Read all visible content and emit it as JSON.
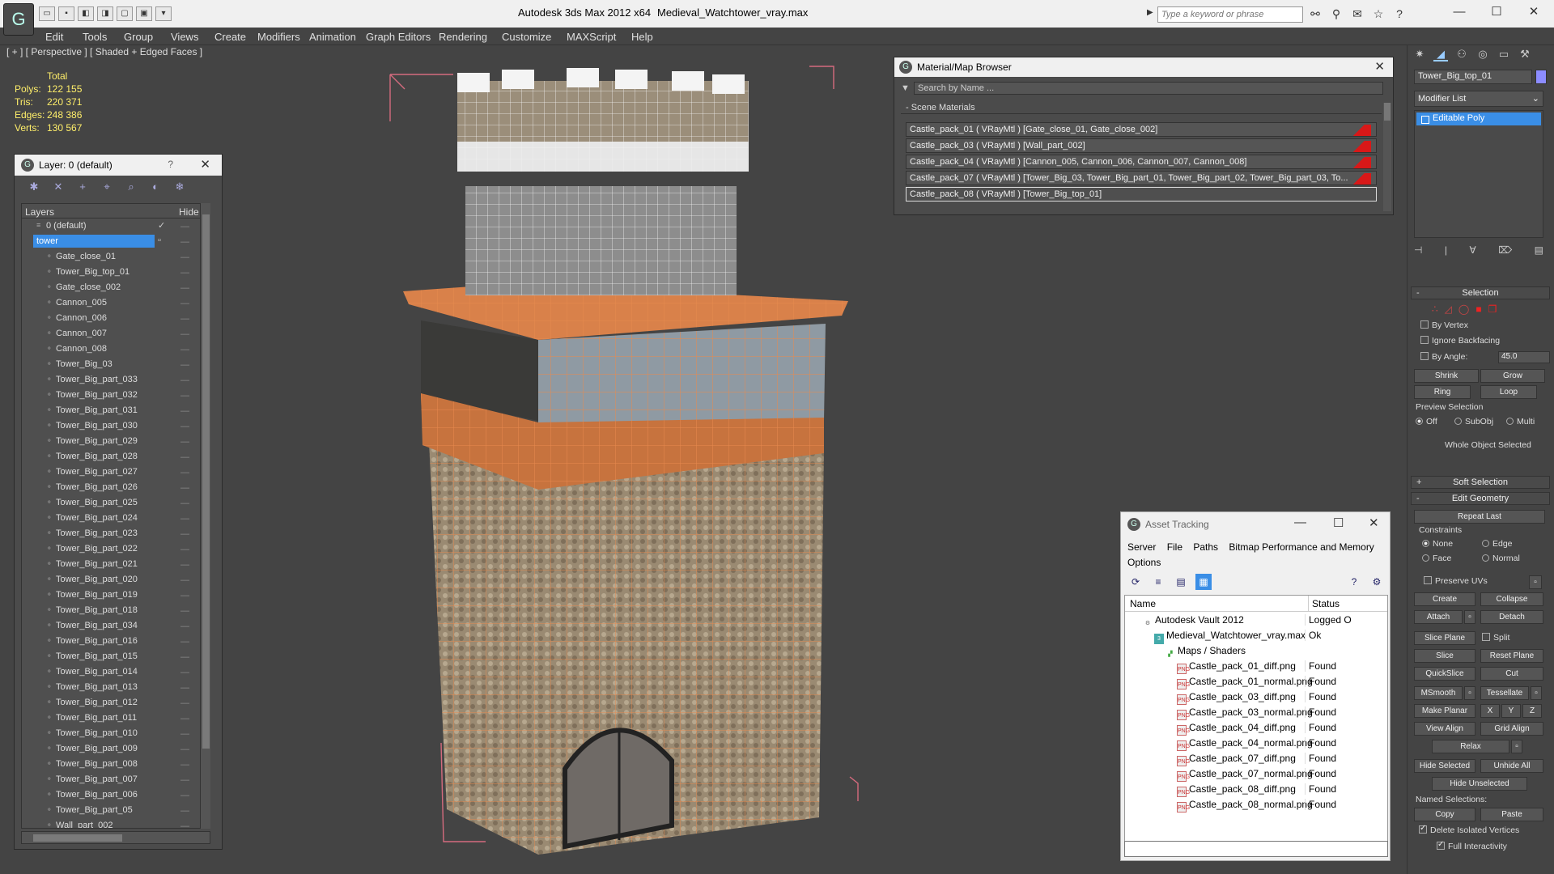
{
  "titlebar": {
    "app_title": "Autodesk 3ds Max  2012 x64",
    "file_title": "Medieval_Watchtower_vray.max",
    "search_placeholder": "Type a keyword or phrase",
    "window_controls": [
      "—",
      "☐",
      "✕"
    ]
  },
  "menu": [
    "Edit",
    "Tools",
    "Group",
    "Views",
    "Create",
    "Modifiers",
    "Animation",
    "Graph Editors",
    "Rendering",
    "Customize",
    "MAXScript",
    "Help"
  ],
  "viewport": {
    "label": "[ + ] [ Perspective ] [ Shaded + Edged Faces ]",
    "stats_header": "Total",
    "stats": [
      {
        "label": "Polys:",
        "value": "122 155"
      },
      {
        "label": "Tris:",
        "value": "220 371"
      },
      {
        "label": "Edges:",
        "value": "248 386"
      },
      {
        "label": "Verts:",
        "value": "130 567"
      }
    ]
  },
  "layer_panel": {
    "title": "Layer: 0 (default)",
    "help": "?",
    "col_layers": "Layers",
    "col_hide": "Hide",
    "rows": [
      {
        "name": "0 (default)",
        "level": 1,
        "checked": true
      },
      {
        "name": "tower",
        "level": 1,
        "selected": true
      },
      {
        "name": "Gate_close_01",
        "level": 2
      },
      {
        "name": "Tower_Big_top_01",
        "level": 2
      },
      {
        "name": "Gate_close_002",
        "level": 2
      },
      {
        "name": "Cannon_005",
        "level": 2
      },
      {
        "name": "Cannon_006",
        "level": 2
      },
      {
        "name": "Cannon_007",
        "level": 2
      },
      {
        "name": "Cannon_008",
        "level": 2
      },
      {
        "name": "Tower_Big_03",
        "level": 2
      },
      {
        "name": "Tower_Big_part_033",
        "level": 2
      },
      {
        "name": "Tower_Big_part_032",
        "level": 2
      },
      {
        "name": "Tower_Big_part_031",
        "level": 2
      },
      {
        "name": "Tower_Big_part_030",
        "level": 2
      },
      {
        "name": "Tower_Big_part_029",
        "level": 2
      },
      {
        "name": "Tower_Big_part_028",
        "level": 2
      },
      {
        "name": "Tower_Big_part_027",
        "level": 2
      },
      {
        "name": "Tower_Big_part_026",
        "level": 2
      },
      {
        "name": "Tower_Big_part_025",
        "level": 2
      },
      {
        "name": "Tower_Big_part_024",
        "level": 2
      },
      {
        "name": "Tower_Big_part_023",
        "level": 2
      },
      {
        "name": "Tower_Big_part_022",
        "level": 2
      },
      {
        "name": "Tower_Big_part_021",
        "level": 2
      },
      {
        "name": "Tower_Big_part_020",
        "level": 2
      },
      {
        "name": "Tower_Big_part_019",
        "level": 2
      },
      {
        "name": "Tower_Big_part_018",
        "level": 2
      },
      {
        "name": "Tower_Big_part_034",
        "level": 2
      },
      {
        "name": "Tower_Big_part_016",
        "level": 2
      },
      {
        "name": "Tower_Big_part_015",
        "level": 2
      },
      {
        "name": "Tower_Big_part_014",
        "level": 2
      },
      {
        "name": "Tower_Big_part_013",
        "level": 2
      },
      {
        "name": "Tower_Big_part_012",
        "level": 2
      },
      {
        "name": "Tower_Big_part_011",
        "level": 2
      },
      {
        "name": "Tower_Big_part_010",
        "level": 2
      },
      {
        "name": "Tower_Big_part_009",
        "level": 2
      },
      {
        "name": "Tower_Big_part_008",
        "level": 2
      },
      {
        "name": "Tower_Big_part_007",
        "level": 2
      },
      {
        "name": "Tower_Big_part_006",
        "level": 2
      },
      {
        "name": "Tower_Big_part_05",
        "level": 2
      },
      {
        "name": "Wall_part_002",
        "level": 2
      }
    ]
  },
  "material_browser": {
    "title": "Material/Map Browser",
    "search_placeholder": "Search by Name ...",
    "group": "Scene Materials",
    "rows": [
      "Castle_pack_01  ( VRayMtl ) [Gate_close_01, Gate_close_002]",
      "Castle_pack_03  ( VRayMtl ) [Wall_part_002]",
      "Castle_pack_04  ( VRayMtl ) [Cannon_005, Cannon_006, Cannon_007, Cannon_008]",
      "Castle_pack_07  ( VRayMtl ) [Tower_Big_03, Tower_Big_part_01, Tower_Big_part_02, Tower_Big_part_03, To...",
      "Castle_pack_08  ( VRayMtl ) [Tower_Big_top_01]"
    ]
  },
  "asset_tracking": {
    "title": "Asset Tracking",
    "menu": [
      "Server",
      "File",
      "Paths",
      "Bitmap Performance and Memory",
      "Options"
    ],
    "col_name": "Name",
    "col_status": "Status",
    "rows": [
      {
        "name": "Autodesk Vault 2012",
        "status": "Logged O",
        "indent": 1,
        "icon": "vault"
      },
      {
        "name": "Medieval_Watchtower_vray.max",
        "status": "Ok",
        "indent": 2,
        "icon": "max"
      },
      {
        "name": "Maps / Shaders",
        "status": "",
        "indent": 3,
        "icon": "folder"
      },
      {
        "name": "Castle_pack_01_diff.png",
        "status": "Found",
        "indent": 4,
        "icon": "png"
      },
      {
        "name": "Castle_pack_01_normal.png",
        "status": "Found",
        "indent": 4,
        "icon": "png"
      },
      {
        "name": "Castle_pack_03_diff.png",
        "status": "Found",
        "indent": 4,
        "icon": "png"
      },
      {
        "name": "Castle_pack_03_normal.png",
        "status": "Found",
        "indent": 4,
        "icon": "png"
      },
      {
        "name": "Castle_pack_04_diff.png",
        "status": "Found",
        "indent": 4,
        "icon": "png"
      },
      {
        "name": "Castle_pack_04_normal.png",
        "status": "Found",
        "indent": 4,
        "icon": "png"
      },
      {
        "name": "Castle_pack_07_diff.png",
        "status": "Found",
        "indent": 4,
        "icon": "png"
      },
      {
        "name": "Castle_pack_07_normal.png",
        "status": "Found",
        "indent": 4,
        "icon": "png"
      },
      {
        "name": "Castle_pack_08_diff.png",
        "status": "Found",
        "indent": 4,
        "icon": "png"
      },
      {
        "name": "Castle_pack_08_normal.png",
        "status": "Found",
        "indent": 4,
        "icon": "png"
      }
    ]
  },
  "command_panel": {
    "object_name": "Tower_Big_top_01",
    "modifier_list": "Modifier List",
    "stack_item": "Editable Poly",
    "selection": {
      "title": "Selection",
      "by_vertex": "By Vertex",
      "ignore_backfacing": "Ignore Backfacing",
      "by_angle": "By Angle:",
      "angle_value": "45.0",
      "shrink": "Shrink",
      "grow": "Grow",
      "ring": "Ring",
      "loop": "Loop",
      "preview_selection": "Preview Selection",
      "preview_off": "Off",
      "preview_subobj": "SubObj",
      "preview_multi": "Multi",
      "whole_object": "Whole Object Selected"
    },
    "soft_selection": "Soft Selection",
    "edit_geometry": {
      "title": "Edit Geometry",
      "repeat_last": "Repeat Last",
      "constraints": "Constraints",
      "c_none": "None",
      "c_edge": "Edge",
      "c_face": "Face",
      "c_normal": "Normal",
      "preserve_uvs": "Preserve UVs",
      "create": "Create",
      "collapse": "Collapse",
      "attach": "Attach",
      "detach": "Detach",
      "slice_plane": "Slice Plane",
      "split": "Split",
      "slice": "Slice",
      "reset_plane": "Reset Plane",
      "quickslice": "QuickSlice",
      "cut": "Cut",
      "msmooth": "MSmooth",
      "tessellate": "Tessellate",
      "make_planar": "Make Planar",
      "x": "X",
      "y": "Y",
      "z": "Z",
      "view_align": "View Align",
      "grid_align": "Grid Align",
      "relax": "Relax",
      "hide_selected": "Hide Selected",
      "unhide_all": "Unhide All",
      "hide_unselected": "Hide Unselected",
      "named_selections": "Named Selections:",
      "copy": "Copy",
      "paste": "Paste",
      "delete_isolated": "Delete Isolated Vertices",
      "full_interactivity": "Full Interactivity"
    }
  },
  "colors": {
    "accent": "#3a8ee6",
    "wire": "#e88a4e",
    "bbox": "#d56b7e",
    "stats": "#ffef6a"
  }
}
